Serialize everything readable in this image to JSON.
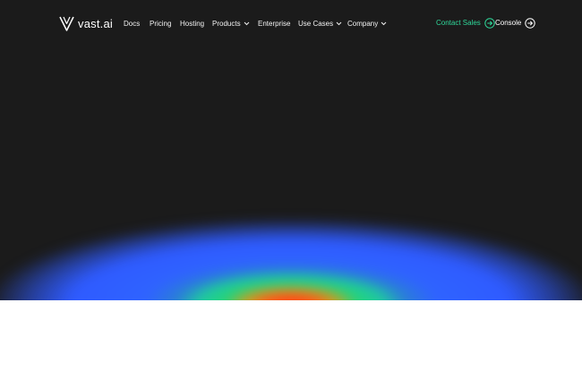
{
  "brand": {
    "name": "vast.ai"
  },
  "nav": {
    "docs": "Docs",
    "pricing": "Pricing",
    "hosting": "Hosting",
    "products": "Products",
    "enterprise": "Enterprise",
    "use_cases": "Use Cases",
    "company": "Company"
  },
  "actions": {
    "contact_sales": "Contact Sales",
    "console": "Console"
  },
  "colors": {
    "background": "#1b1b1b",
    "accent_green": "#2fd89a",
    "text": "#f2f2f2",
    "glow_blue": "#2f5bff",
    "glow_red": "#ff3a14"
  },
  "icons": {
    "logo": "vast-v-logo-icon",
    "dropdown": "chevron-down-icon",
    "cta": "arrow-right-circle-icon"
  }
}
